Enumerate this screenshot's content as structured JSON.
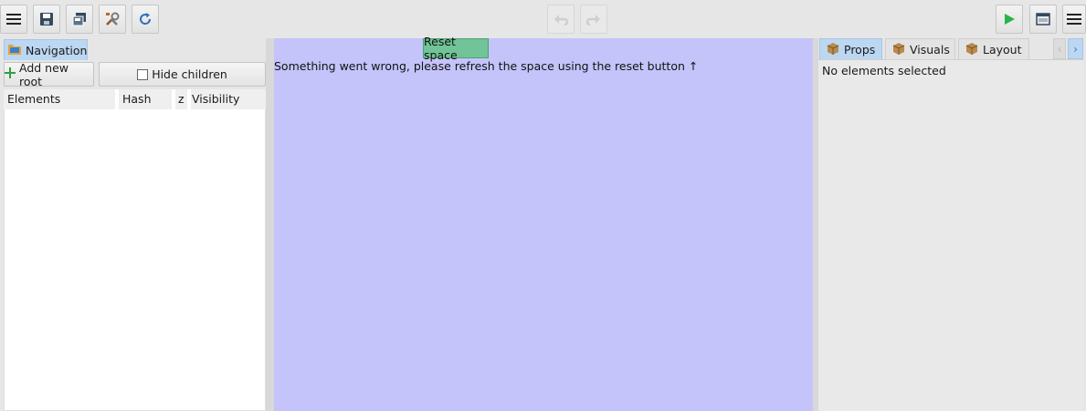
{
  "toolbar": {
    "left_buttons": [
      "menu-icon",
      "save-icon",
      "save-as-icon",
      "tools-icon",
      "refresh-icon"
    ],
    "center_buttons": [
      "undo-icon",
      "redo-icon"
    ],
    "right_buttons": [
      "play-icon",
      "window-icon",
      "menu-icon"
    ],
    "colors": {
      "play": "#2bb24c",
      "refresh": "#2f6fb8",
      "icon": "#35495e"
    }
  },
  "left_panel": {
    "tab_label": "Navigation",
    "add_root_label": "Add new root",
    "hide_children_label": "Hide children",
    "columns": [
      "Elements",
      "Hash",
      "z",
      "Visibility"
    ],
    "rows": []
  },
  "canvas": {
    "reset_button_label": "Reset space",
    "error_message": "Something went wrong, please refresh the space using the reset button ↑",
    "background": "#c4c4fb",
    "reset_color": "#71c497"
  },
  "right_panel": {
    "tabs": [
      "Props",
      "Visuals",
      "Layout"
    ],
    "active_tab": "Props",
    "empty_message": "No elements selected"
  }
}
